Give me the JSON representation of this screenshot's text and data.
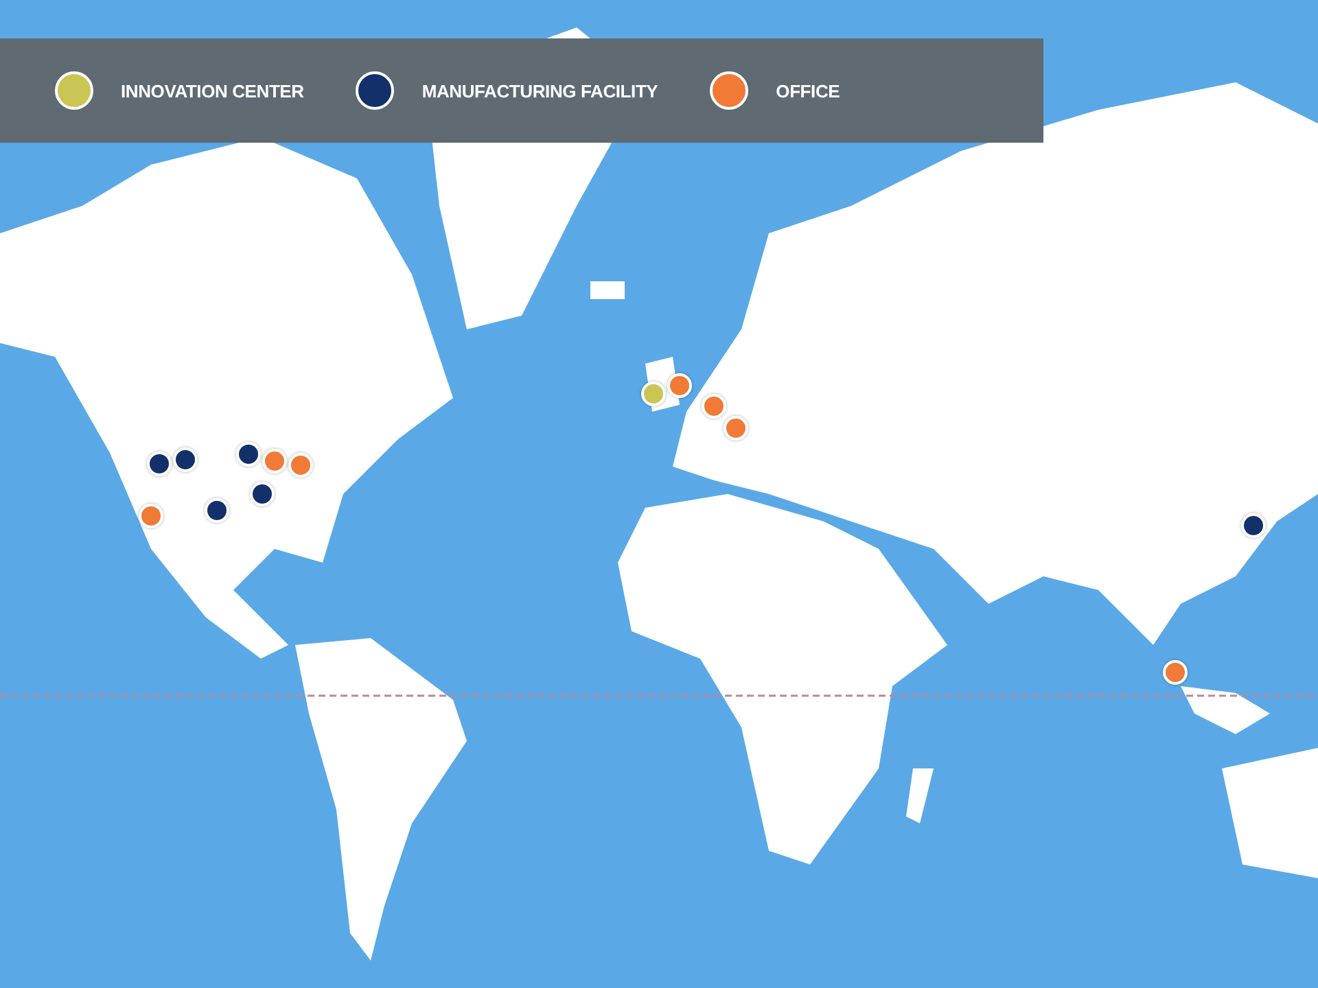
{
  "legend": [
    {
      "label": "INNOVATION CENTER",
      "color": "#c9c653"
    },
    {
      "label": "MANUFACTURING FACILITY",
      "color": "#14306b"
    },
    {
      "label": "OFFICE",
      "color": "#f07a36"
    }
  ],
  "pins": [
    {
      "color": "#14306b"
    },
    {
      "color": "#14306b"
    },
    {
      "color": "#14306b"
    },
    {
      "color": "#14306b"
    },
    {
      "color": "#14306b"
    },
    {
      "color": "#14306b"
    },
    {
      "color": "#f07a36"
    },
    {
      "color": "#f07a36"
    },
    {
      "color": "#f07a36"
    },
    {
      "color": "#f07a36"
    },
    {
      "color": "#f07a36"
    },
    {
      "color": "#f07a36"
    },
    {
      "color": "#f07a36"
    },
    {
      "color": "#c9c653"
    }
  ]
}
